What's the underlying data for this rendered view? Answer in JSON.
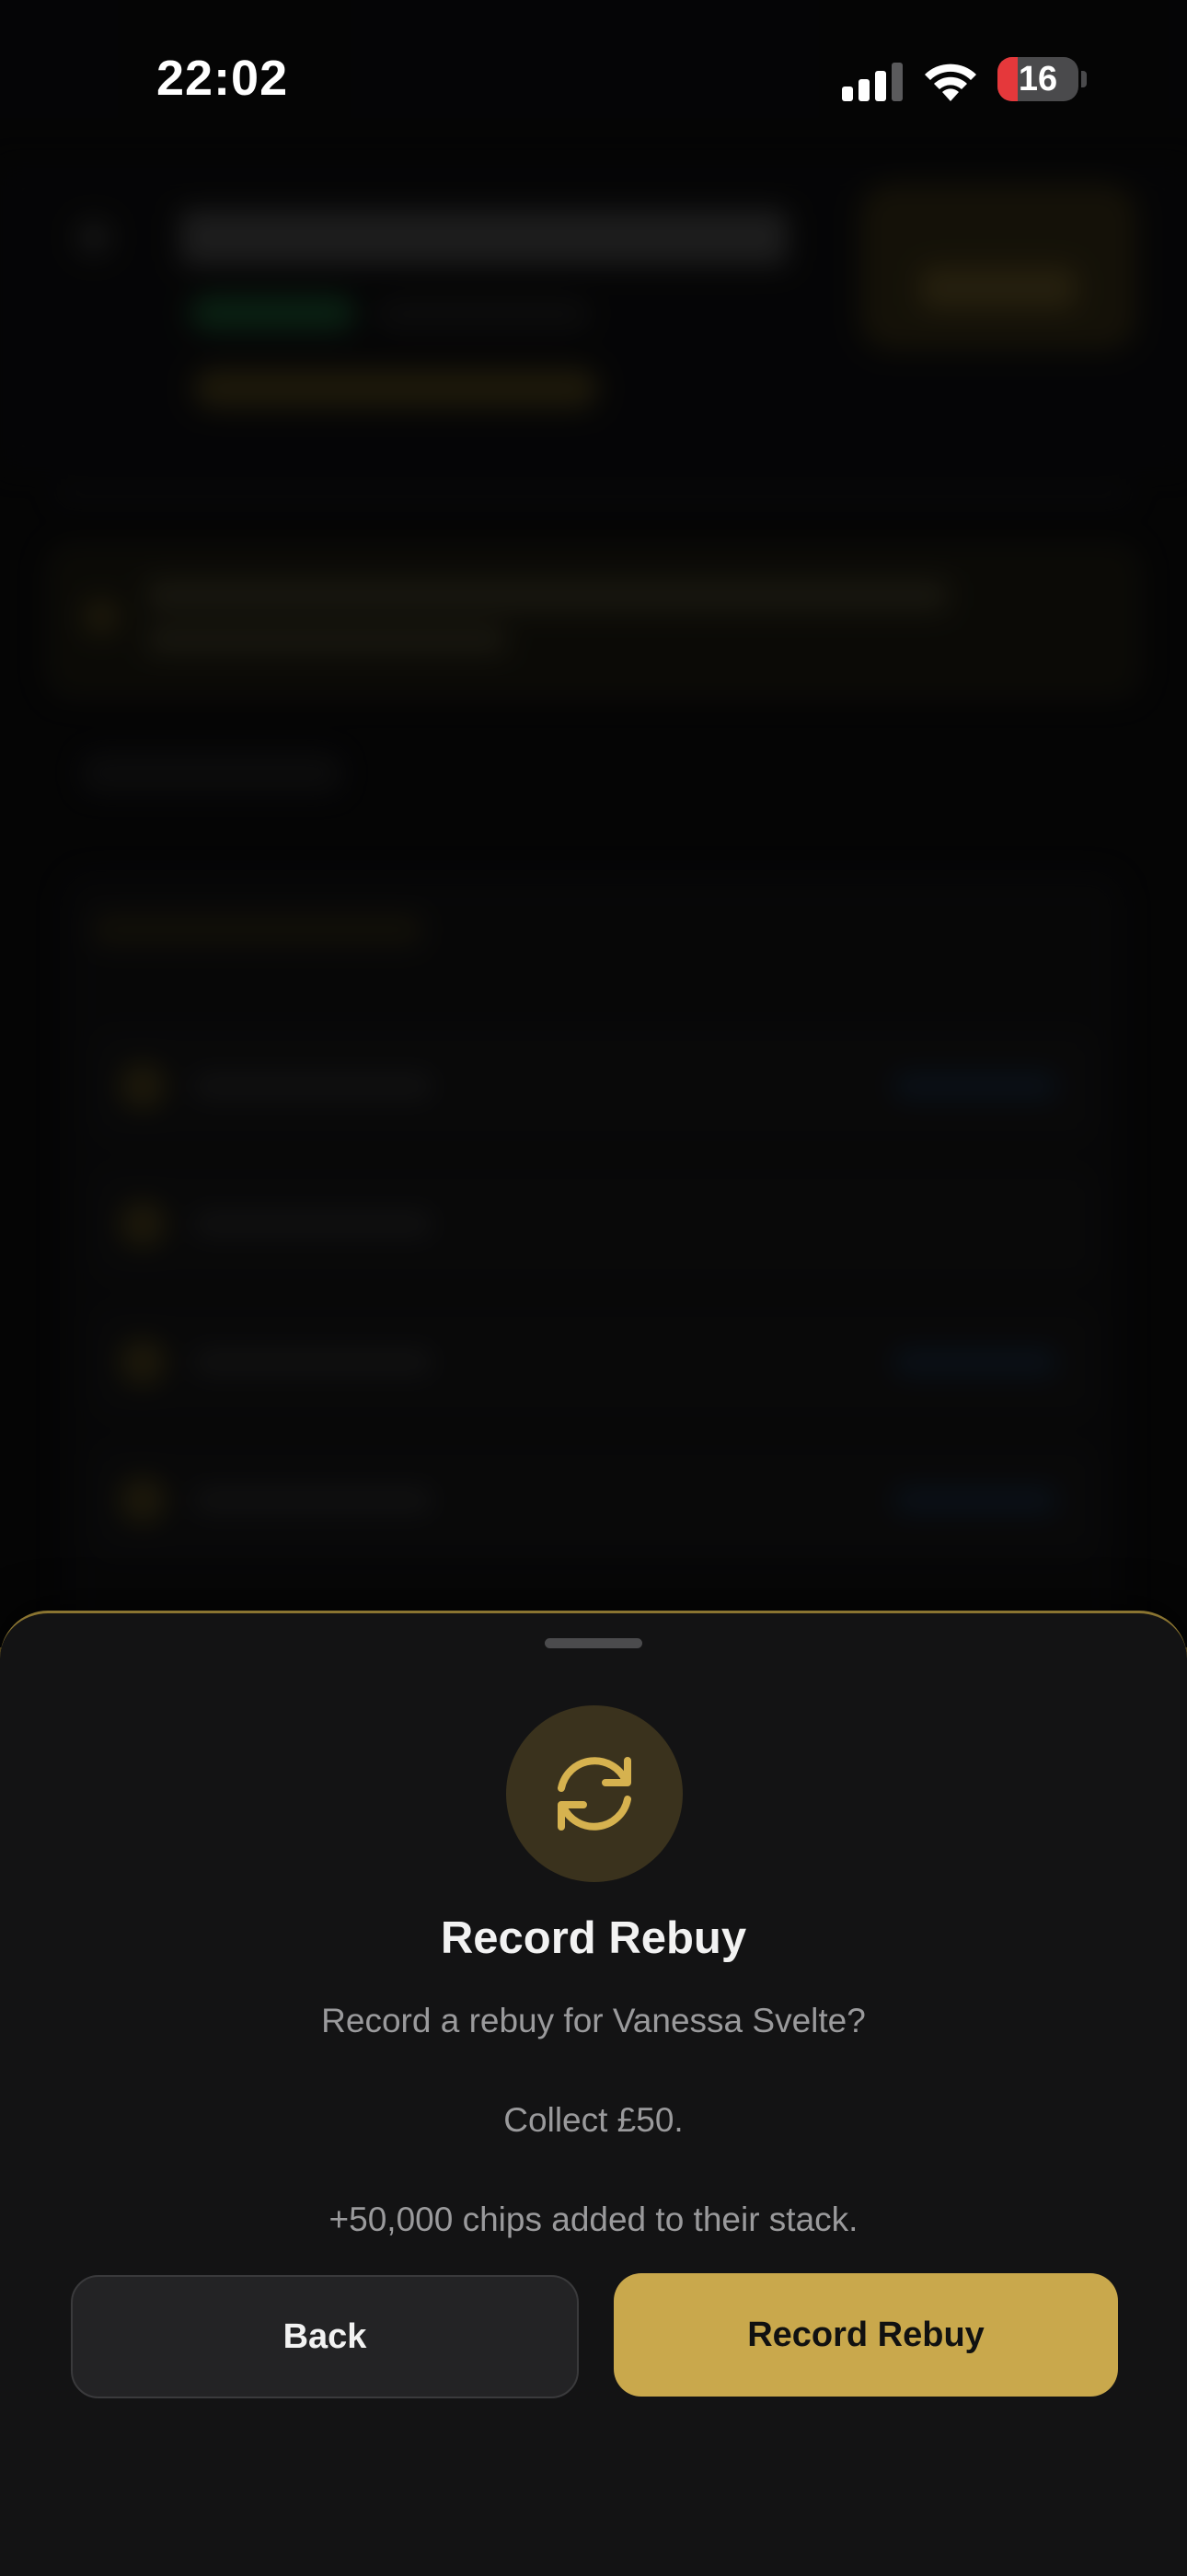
{
  "status_bar": {
    "time": "22:02",
    "battery_percent": "16",
    "icons": [
      "signal-icon",
      "wifi-icon",
      "battery-icon"
    ]
  },
  "sheet": {
    "icon": "refresh-icon",
    "title": "Record Rebuy",
    "message_line1": "Record a rebuy for Vanessa Svelte?",
    "message_line2": "Collect £50.",
    "message_line3": "+50,000 chips added to their stack.",
    "back_label": "Back",
    "confirm_label": "Record Rebuy"
  },
  "colors": {
    "accent": "#c9a84c",
    "sheet_background": "#131314",
    "battery_low": "#e5383b"
  }
}
